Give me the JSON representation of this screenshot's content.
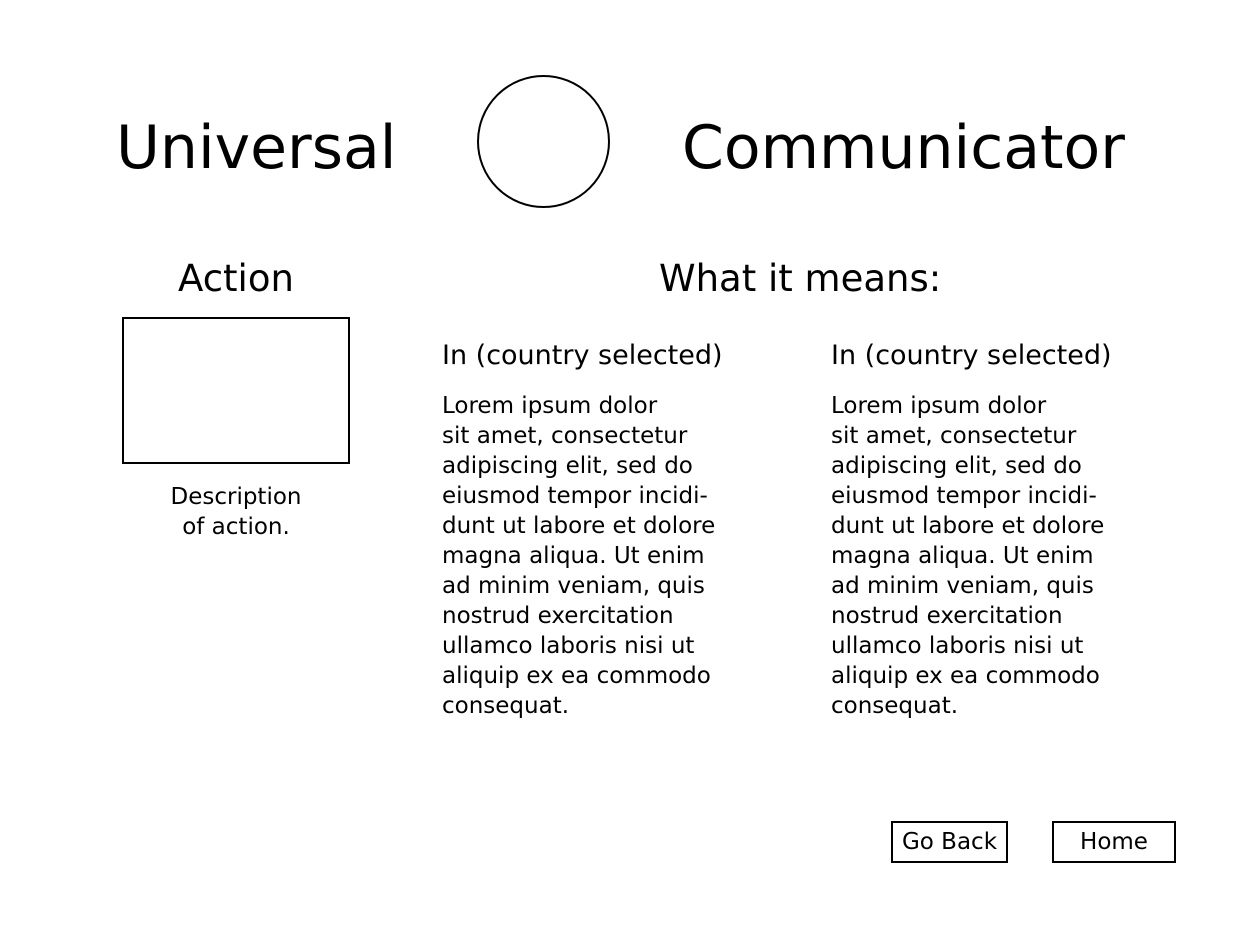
{
  "header": {
    "title_left": "Universal",
    "title_right": "Communicator",
    "logo_icon": "circle-logo-icon"
  },
  "action": {
    "heading": "Action",
    "image_icon": "action-image-placeholder",
    "description": "Description\nof action."
  },
  "meaning": {
    "heading": "What it means:",
    "columns": [
      {
        "heading": "In (country selected)",
        "body": "Lorem ipsum dolor\nsit amet, consectetur\nadipiscing elit, sed do\neiusmod tempor incidi-\ndunt ut labore et dolore\nmagna aliqua. Ut enim\nad minim veniam, quis\nnostrud exercitation\nullamco laboris nisi ut\naliquip ex ea commodo\nconsequat."
      },
      {
        "heading": "In (country selected)",
        "body": "Lorem ipsum dolor\nsit amet, consectetur\nadipiscing elit, sed do\neiusmod tempor incidi-\ndunt ut labore et dolore\nmagna aliqua. Ut enim\nad minim veniam, quis\nnostrud exercitation\nullamco laboris nisi ut\naliquip ex ea commodo\nconsequat."
      }
    ]
  },
  "nav": {
    "go_back_label": "Go Back",
    "home_label": "Home"
  }
}
